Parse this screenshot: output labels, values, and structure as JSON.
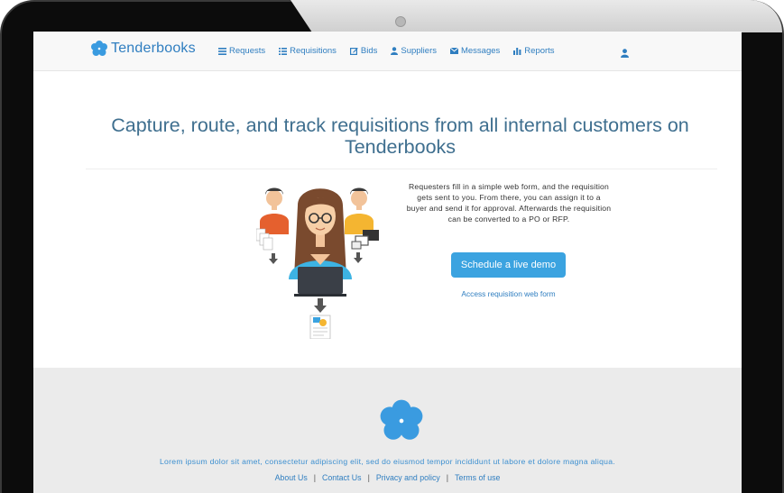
{
  "brand": {
    "name": "Tenderbooks",
    "logo_icon": "flower-logo-icon",
    "color": "#3a9be0"
  },
  "nav": {
    "items": [
      {
        "label": "Requests",
        "icon": "list-icon"
      },
      {
        "label": "Requisitions",
        "icon": "table-icon"
      },
      {
        "label": "Bids",
        "icon": "edit-icon"
      },
      {
        "label": "Suppliers",
        "icon": "user-icon"
      },
      {
        "label": "Messages",
        "icon": "envelope-icon"
      },
      {
        "label": "Reports",
        "icon": "bar-chart-icon"
      }
    ],
    "user_icon": "user-icon"
  },
  "hero": {
    "headline": "Capture, route, and track requisitions from all internal customers on Tenderbooks",
    "blurb": "Requesters fill in a simple web form, and the requisition gets sent to you. From there, you can assign it to a buyer and send it for approval. Afterwards the requisition can be converted to a PO or RFP.",
    "cta_label": "Schedule a live demo",
    "link_label": "Access requisition web form"
  },
  "footer": {
    "text": "Lorem ipsum dolor sit amet, consectetur adipiscing elit, sed do eiusmod tempor incididunt ut labore et dolore magna aliqua.",
    "links": [
      "About Us",
      "Contact Us",
      "Privacy and policy",
      "Terms of use"
    ],
    "separator": "|"
  },
  "colors": {
    "accent": "#3ba3e0",
    "link": "#2f7ec0",
    "heading": "#3f6f8f",
    "footer_bg": "#ebebeb"
  }
}
